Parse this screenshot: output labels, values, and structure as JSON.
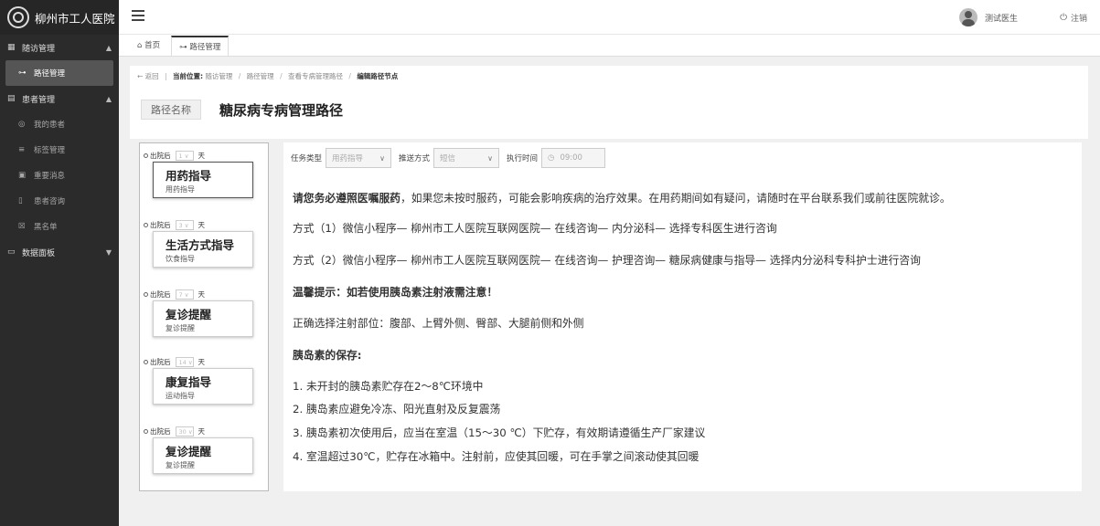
{
  "app": {
    "title": "柳州市工人医院"
  },
  "sidebar": {
    "groups": [
      {
        "label": "随访管理",
        "icon": "grid-icon",
        "chev": "▲"
      },
      {
        "label": "患者管理",
        "icon": "list-icon",
        "chev": "▲"
      },
      {
        "label": "数据面板",
        "icon": "monitor-icon",
        "chev": "▼"
      }
    ],
    "items": [
      {
        "label": "路径管理"
      },
      {
        "label": "我的患者"
      },
      {
        "label": "标签管理"
      },
      {
        "label": "重要消息"
      },
      {
        "label": "患者咨询"
      },
      {
        "label": "黑名单"
      }
    ]
  },
  "header": {
    "user": "测试医生",
    "logout": "注销"
  },
  "tabs": [
    {
      "label": "首页",
      "icon": "home-icon"
    },
    {
      "label": "路径管理"
    }
  ],
  "breadcrumb": {
    "back": "← 返回",
    "current_label": "当前位置:",
    "items": [
      "随访管理",
      "路径管理",
      "查看专病管理路径",
      "编辑路径节点"
    ]
  },
  "path": {
    "label": "路径名称",
    "name": "糖尿病专病管理路径"
  },
  "timeline": {
    "prefix": "出院后",
    "unit": "天",
    "nodes": [
      {
        "day": "1",
        "title": "用药指导",
        "subtitle": "用药指导"
      },
      {
        "day": "3",
        "title": "生活方式指导",
        "subtitle": "饮食指导"
      },
      {
        "day": "7",
        "title": "复诊提醒",
        "subtitle": "复诊提醒"
      },
      {
        "day": "14",
        "title": "康复指导",
        "subtitle": "运动指导"
      },
      {
        "day": "30",
        "title": "复诊提醒",
        "subtitle": "复诊提醒"
      }
    ]
  },
  "task": {
    "type_label": "任务类型",
    "type_value": "用药指导",
    "push_label": "推送方式",
    "push_value": "短信",
    "time_label": "执行时间",
    "time_value": "09:00"
  },
  "content": {
    "p1_bold": "请您务必遵照医嘱服药",
    "p1_rest": "，如果您未按时服药，可能会影响疾病的治疗效果。在用药期间如有疑问，请随时在平台联系我们或前往医院就诊。",
    "way1": "方式（1）微信小程序— 柳州市工人医院互联网医院— 在线咨询— 内分泌科— 选择专科医生进行咨询",
    "way2": "方式（2）微信小程序— 柳州市工人医院互联网医院— 在线咨询— 护理咨询— 糖尿病健康与指导— 选择内分泌科专科护士进行咨询",
    "tip": "温馨提示：如若使用胰岛素注射液需注意！",
    "sites": "正确选择注射部位：腹部、上臂外侧、臀部、大腿前侧和外侧",
    "storage_title": "胰岛素的保存:",
    "storage_items": [
      "1. 未开封的胰岛素贮存在2～8℃环境中",
      "2. 胰岛素应避免冷冻、阳光直射及反复震荡",
      "3. 胰岛素初次使用后，应当在室温（15～30 ℃）下贮存，有效期请遵循生产厂家建议",
      "4. 室温超过30℃，贮存在冰箱中。注射前，应使其回暖，可在手掌之间滚动使其回暖"
    ]
  }
}
